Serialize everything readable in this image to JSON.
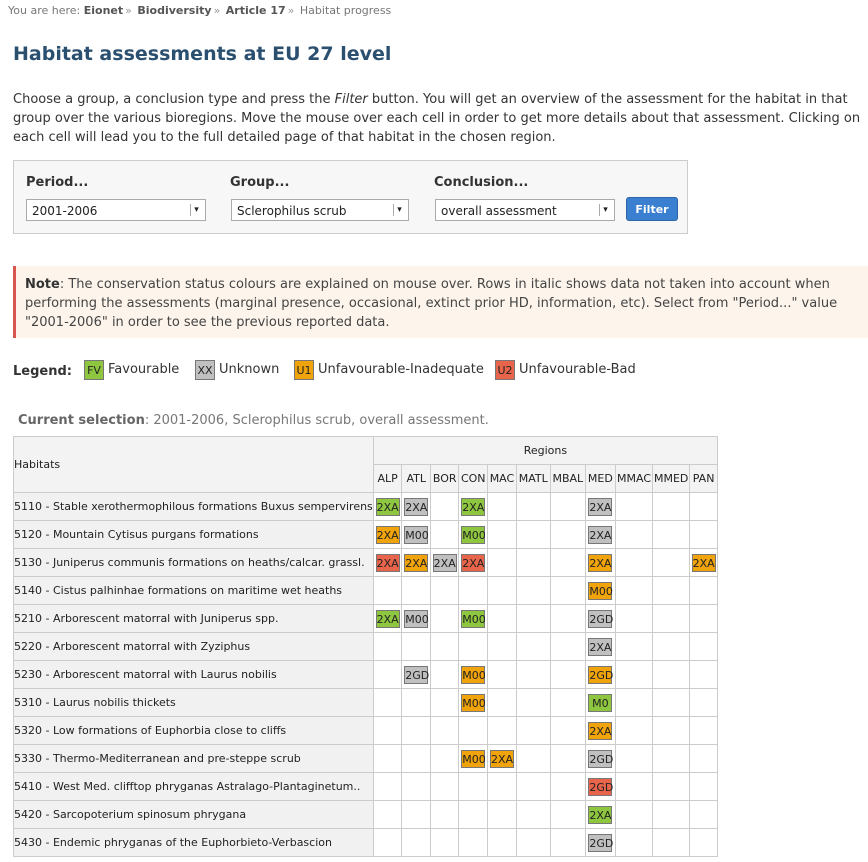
{
  "breadcrumb": {
    "prefix": "You are here:",
    "items": [
      "Eionet",
      "Biodiversity",
      "Article 17"
    ],
    "current": "Habitat progress"
  },
  "title": "Habitat assessments at EU 27 level",
  "intro": {
    "before": "Choose a group, a conclusion type and press the ",
    "emph": "Filter",
    "after": " button. You will get an overview of the assessment for the habitat in that group over the various bioregions. Move the mouse over each cell in order to get more details about that assessment. Clicking on each cell will lead you to the full detailed page of that habitat in the chosen region."
  },
  "filters": {
    "period_label": "Period...",
    "period_value": "2001-2006",
    "group_label": "Group...",
    "group_value": "Sclerophilus scrub",
    "conclusion_label": "Conclusion...",
    "conclusion_value": "overall assessment",
    "button": "Filter"
  },
  "note": {
    "label": "Note",
    "text": ": The conservation status colours are explained on mouse over. Rows in italic shows data not taken into account when performing the assessments (marginal presence, occasional, extinct prior HD, information, etc). Select from \"Period...\" value \"2001-2006\" in order to see the previous reported data."
  },
  "legend": {
    "label": "Legend:",
    "items": [
      {
        "code": "FV",
        "text": "Favourable",
        "color": "#8ec63f"
      },
      {
        "code": "XX",
        "text": "Unknown",
        "color": "#c0c0c0"
      },
      {
        "code": "U1",
        "text": "Unfavourable-Inadequate",
        "color": "#f0a30a"
      },
      {
        "code": "U2",
        "text": "Unfavourable-Bad",
        "color": "#e8644a"
      }
    ]
  },
  "current": {
    "label": "Current selection",
    "value": ": 2001-2006, Sclerophilus scrub, overall assessment."
  },
  "table": {
    "habitats_header": "Habitats",
    "regions_header": "Regions",
    "regions": [
      "ALP",
      "ATL",
      "BOR",
      "CON",
      "MAC",
      "MATL",
      "MBAL",
      "MED",
      "MMAC",
      "MMED",
      "PAN"
    ],
    "rows": [
      {
        "name": "5110 - Stable xerothermophilous formations Buxus sempervirens",
        "cells": [
          [
            "2XA",
            "FV"
          ],
          [
            "2XA",
            "XX"
          ],
          null,
          [
            "2XA",
            "FV"
          ],
          null,
          null,
          null,
          [
            "2XA",
            "XX"
          ],
          null,
          null,
          null
        ]
      },
      {
        "name": "5120 - Mountain Cytisus purgans formations",
        "cells": [
          [
            "2XA",
            "U1"
          ],
          [
            "M00",
            "XX"
          ],
          null,
          [
            "M00",
            "FV"
          ],
          null,
          null,
          null,
          [
            "2XA",
            "XX"
          ],
          null,
          null,
          null
        ]
      },
      {
        "name": "5130 - Juniperus communis formations on heaths/calcar. grassl.",
        "cells": [
          [
            "2XA",
            "U2"
          ],
          [
            "2XA",
            "U1"
          ],
          [
            "2XA",
            "XX"
          ],
          [
            "2XA",
            "U2"
          ],
          null,
          null,
          null,
          [
            "2XA",
            "U1"
          ],
          null,
          null,
          [
            "2XA",
            "U1"
          ]
        ]
      },
      {
        "name": "5140 - Cistus palhinhae formations on maritime wet heaths",
        "cells": [
          null,
          null,
          null,
          null,
          null,
          null,
          null,
          [
            "M00",
            "U1"
          ],
          null,
          null,
          null
        ]
      },
      {
        "name": "5210 - Arborescent matorral with Juniperus spp.",
        "cells": [
          [
            "2XA",
            "FV"
          ],
          [
            "M00",
            "XX"
          ],
          null,
          [
            "M00",
            "FV"
          ],
          null,
          null,
          null,
          [
            "2GD",
            "XX"
          ],
          null,
          null,
          null
        ]
      },
      {
        "name": "5220 - Arborescent matorral with Zyziphus",
        "cells": [
          null,
          null,
          null,
          null,
          null,
          null,
          null,
          [
            "2XA",
            "XX"
          ],
          null,
          null,
          null
        ]
      },
      {
        "name": "5230 - Arborescent matorral with Laurus nobilis",
        "cells": [
          null,
          [
            "2GD",
            "XX"
          ],
          null,
          [
            "M00",
            "U1"
          ],
          null,
          null,
          null,
          [
            "2GD",
            "U1"
          ],
          null,
          null,
          null
        ]
      },
      {
        "name": "5310 - Laurus nobilis thickets",
        "cells": [
          null,
          null,
          null,
          [
            "M00",
            "U1"
          ],
          null,
          null,
          null,
          [
            "M0",
            "FV"
          ],
          null,
          null,
          null
        ]
      },
      {
        "name": "5320 - Low formations of Euphorbia close to cliffs",
        "cells": [
          null,
          null,
          null,
          null,
          null,
          null,
          null,
          [
            "2XA",
            "U1"
          ],
          null,
          null,
          null
        ]
      },
      {
        "name": "5330 - Thermo-Mediterranean and pre-steppe scrub",
        "cells": [
          null,
          null,
          null,
          [
            "M00",
            "U1"
          ],
          [
            "2XA",
            "U1"
          ],
          null,
          null,
          [
            "2GD",
            "XX"
          ],
          null,
          null,
          null
        ]
      },
      {
        "name": "5410 - West Med. clifftop phryganas Astralago-Plantaginetum..",
        "cells": [
          null,
          null,
          null,
          null,
          null,
          null,
          null,
          [
            "2GD",
            "U2"
          ],
          null,
          null,
          null
        ]
      },
      {
        "name": "5420 - Sarcopoterium spinosum phrygana",
        "cells": [
          null,
          null,
          null,
          null,
          null,
          null,
          null,
          [
            "2XA",
            "FV"
          ],
          null,
          null,
          null
        ]
      },
      {
        "name": "5430 - Endemic phryganas of the Euphorbieto-Verbascion",
        "cells": [
          null,
          null,
          null,
          null,
          null,
          null,
          null,
          [
            "2GD",
            "XX"
          ],
          null,
          null,
          null
        ]
      }
    ]
  }
}
